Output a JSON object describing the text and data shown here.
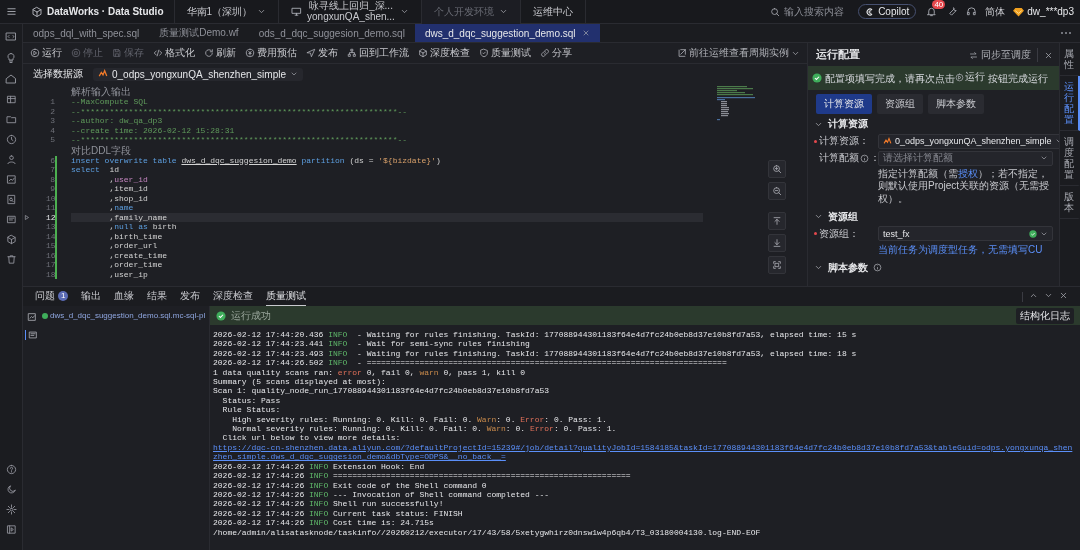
{
  "topbar": {
    "logo": "DataWorks · Data Studio",
    "region": "华南1（深圳）",
    "workspace": {
      "name": "咏寻线上回归_深...",
      "id": "yongxunQA_shen..."
    },
    "env": {
      "label": "个人开发环境",
      "disabled": true
    },
    "ops": "运维中心",
    "search": {
      "placeholder": "输入搜索内容"
    },
    "copilot": "Copilot",
    "notifications": "40",
    "language": "简体",
    "user": "dw_***dp3"
  },
  "tabs": [
    {
      "label": "odps_dql_with_spec.sql",
      "selected": false
    },
    {
      "label": "质量测试Demo.wf",
      "selected": false
    },
    {
      "label": "ods_d_dqc_suggesion_demo.sql",
      "selected": false
    },
    {
      "label": "dws_d_dqc_suggestion_demo.sql",
      "selected": true
    }
  ],
  "toolbar": {
    "actions": [
      {
        "label": "运行",
        "disabled": false
      },
      {
        "label": "停止",
        "disabled": true
      },
      {
        "label": "保存",
        "disabled": true
      },
      {
        "label": "格式化",
        "disabled": false
      },
      {
        "label": "刷新",
        "disabled": false
      },
      {
        "label": "费用预估",
        "disabled": false
      },
      {
        "label": "发布",
        "disabled": false
      },
      {
        "label": "回到工作流",
        "disabled": false
      },
      {
        "label": "深度检查",
        "disabled": false
      },
      {
        "label": "质量测试",
        "disabled": false
      },
      {
        "label": "分享",
        "disabled": false
      }
    ],
    "goto": "前往运维查看周期实例"
  },
  "datasource": {
    "label": "选择数据源",
    "value": "0_odps_yongxunQA_shenzhen_simple"
  },
  "editor": {
    "lines": [
      {
        "kind": "lens",
        "text": "解析输入输出"
      },
      {
        "kind": "code",
        "number": "1",
        "current": false,
        "changed": false,
        "run_button": false,
        "tokens": [
          {
            "kind": "comment",
            "text": "--MaxCompute SQL"
          }
        ]
      },
      {
        "kind": "code",
        "number": "2",
        "current": false,
        "changed": false,
        "run_button": false,
        "tokens": [
          {
            "kind": "comment",
            "text": "--******************************************************************--"
          }
        ]
      },
      {
        "kind": "code",
        "number": "3",
        "current": false,
        "changed": false,
        "run_button": false,
        "tokens": [
          {
            "kind": "comment",
            "text": "--author: dw_qa_dp3"
          }
        ]
      },
      {
        "kind": "code",
        "number": "4",
        "current": false,
        "changed": false,
        "run_button": false,
        "tokens": [
          {
            "kind": "comment",
            "text": "--create time: 2026-02-12 15:28:31"
          }
        ]
      },
      {
        "kind": "code",
        "number": "5",
        "current": false,
        "changed": false,
        "run_button": false,
        "tokens": [
          {
            "kind": "comment",
            "text": "--******************************************************************--"
          }
        ]
      },
      {
        "kind": "lens",
        "text": "对比DDL字段"
      },
      {
        "kind": "code",
        "number": "6",
        "current": false,
        "changed": true,
        "run_button": false,
        "tokens": [
          {
            "kind": "keyword",
            "text": "insert overwrite table "
          },
          {
            "kind": "table",
            "text": "dws_d_dqc_suggesion_demo"
          },
          {
            "kind": "keyword",
            "text": " partition"
          },
          {
            "kind": "plain",
            "text": " (ds = "
          },
          {
            "kind": "string",
            "text": "'${bizdate}'"
          },
          {
            "kind": "plain",
            "text": ")"
          }
        ]
      },
      {
        "kind": "code",
        "number": "7",
        "current": false,
        "changed": true,
        "run_button": false,
        "tokens": [
          {
            "kind": "keyword",
            "text": "select"
          },
          {
            "kind": "plain",
            "text": "  id"
          }
        ]
      },
      {
        "kind": "code",
        "number": "8",
        "current": false,
        "changed": true,
        "run_button": false,
        "tokens": [
          {
            "kind": "plain",
            "text": "        ,"
          },
          {
            "kind": "field",
            "text": "user_id"
          }
        ]
      },
      {
        "kind": "code",
        "number": "9",
        "current": false,
        "changed": true,
        "run_button": false,
        "tokens": [
          {
            "kind": "plain",
            "text": "        ,item_id"
          }
        ]
      },
      {
        "kind": "code",
        "number": "10",
        "current": false,
        "changed": true,
        "run_button": false,
        "tokens": [
          {
            "kind": "plain",
            "text": "        ,shop_id"
          }
        ]
      },
      {
        "kind": "code",
        "number": "11",
        "current": false,
        "changed": true,
        "run_button": false,
        "tokens": [
          {
            "kind": "plain",
            "text": "        ,"
          },
          {
            "kind": "keyword",
            "text": "name"
          }
        ]
      },
      {
        "kind": "code",
        "number": "12",
        "current": true,
        "changed": true,
        "run_button": true,
        "tokens": [
          {
            "kind": "plain",
            "text": "        ,family_name"
          }
        ]
      },
      {
        "kind": "code",
        "number": "13",
        "current": false,
        "changed": true,
        "run_button": false,
        "tokens": [
          {
            "kind": "plain",
            "text": "        ,"
          },
          {
            "kind": "keyword",
            "text": "null as"
          },
          {
            "kind": "plain",
            "text": " birth"
          }
        ]
      },
      {
        "kind": "code",
        "number": "14",
        "current": false,
        "changed": true,
        "run_button": false,
        "tokens": [
          {
            "kind": "plain",
            "text": "        ,birth_time"
          }
        ]
      },
      {
        "kind": "code",
        "number": "15",
        "current": false,
        "changed": true,
        "run_button": false,
        "tokens": [
          {
            "kind": "plain",
            "text": "        ,order_url"
          }
        ]
      },
      {
        "kind": "code",
        "number": "16",
        "current": false,
        "changed": true,
        "run_button": false,
        "tokens": [
          {
            "kind": "plain",
            "text": "        ,create_time"
          }
        ]
      },
      {
        "kind": "code",
        "number": "17",
        "current": false,
        "changed": true,
        "run_button": false,
        "tokens": [
          {
            "kind": "plain",
            "text": "        ,order_time"
          }
        ]
      },
      {
        "kind": "code",
        "number": "18",
        "current": false,
        "changed": true,
        "run_button": false,
        "tokens": [
          {
            "kind": "plain",
            "text": "        ,user_ip"
          }
        ]
      }
    ]
  },
  "config": {
    "title": "运行配置",
    "sync": "同步至调度",
    "banner": {
      "before": "配置项填写完成，请再次点击",
      "button": "运行",
      "after": "按钮完成运行"
    },
    "tabs": [
      {
        "label": "计算资源",
        "selected": true
      },
      {
        "label": "资源组",
        "selected": false
      },
      {
        "label": "脚本参数",
        "selected": false
      }
    ],
    "sections": [
      {
        "title": "计算资源",
        "info": false,
        "expanded": true,
        "items": [
          {
            "kind": "source_select",
            "label": "计算资源",
            "colon": "：",
            "required": true,
            "info": false,
            "valid": false,
            "value": "0_odps_yongxunQA_shenzhen_simple"
          },
          {
            "kind": "select",
            "label": "计算配额",
            "colon": "：",
            "required": false,
            "info": true,
            "valid": false,
            "placeholder": "请选择计算配额"
          },
          {
            "kind": "help",
            "before": "指定计算配额（需",
            "link": "授权",
            "after": "）；若不指定，则默认使用Project关联的资源（无需授权）。"
          }
        ]
      },
      {
        "title": "资源组",
        "info": false,
        "expanded": true,
        "items": [
          {
            "kind": "select",
            "label": "资源组",
            "colon": "：",
            "required": true,
            "info": false,
            "valid": true,
            "value": "test_fx"
          },
          {
            "kind": "note",
            "text": "当前任务为调度型任务，无需填写CU"
          }
        ]
      },
      {
        "title": "脚本参数",
        "info": true,
        "expanded": true
      }
    ]
  },
  "side_tabs": [
    {
      "label": "属性",
      "selected": false
    },
    {
      "label": "运行配置",
      "selected": true
    },
    {
      "label": "调度配置",
      "selected": false
    },
    {
      "label": "版本",
      "selected": false
    }
  ],
  "bottom": {
    "tabs": [
      {
        "label": "问题",
        "badge": "1",
        "selected": false
      },
      {
        "label": "输出",
        "selected": false
      },
      {
        "label": "血缘",
        "selected": false
      },
      {
        "label": "结果",
        "selected": false
      },
      {
        "label": "发布",
        "selected": false
      },
      {
        "label": "深度检查",
        "selected": false
      },
      {
        "label": "质量测试",
        "selected": true
      }
    ],
    "files": [
      {
        "name": "dws_d_dqc_suggestion_demo.sql.mc-sql-pl",
        "succeeded": true
      }
    ],
    "log": {
      "succeeded": true,
      "status_text": "运行成功",
      "structured_button": "结构化日志",
      "lines": [
        [
          {
            "kind": "plain",
            "text": "2026-02-12 17:44:20.436 "
          },
          {
            "kind": "info",
            "text": "INFO"
          },
          {
            "kind": "plain",
            "text": "  - Waiting for rules finishing. TaskId: 177088944301183f64e4d7fc24b0eb8d37e10b8fd7a53, elapsed time: 15 s"
          }
        ],
        [
          {
            "kind": "plain",
            "text": "2026-02-12 17:44:23.441 "
          },
          {
            "kind": "info",
            "text": "INFO"
          },
          {
            "kind": "plain",
            "text": "  - Wait for semi-sync rules finishing"
          }
        ],
        [
          {
            "kind": "plain",
            "text": "2026-02-12 17:44:23.493 "
          },
          {
            "kind": "info",
            "text": "INFO"
          },
          {
            "kind": "plain",
            "text": "  - Waiting for rules finishing. TaskId: 177088944301183f64e4d7fc24b0eb8d37e10b8fd7a53, elapsed time: 18 s"
          }
        ],
        [
          {
            "kind": "plain",
            "text": "2026-02-12 17:44:26.502 "
          },
          {
            "kind": "info",
            "text": "INFO"
          },
          {
            "kind": "plain",
            "text": "  - ==========================================================================="
          }
        ],
        [
          {
            "kind": "plain",
            "text": "1 data quality scans ran: "
          },
          {
            "kind": "error",
            "text": "error"
          },
          {
            "kind": "plain",
            "text": " 0, fail 0, "
          },
          {
            "kind": "warn",
            "text": "warn"
          },
          {
            "kind": "plain",
            "text": " 0, pass 1, kill 0"
          }
        ],
        [
          {
            "kind": "plain",
            "text": "Summary (5 scans displayed at most):"
          }
        ],
        [
          {
            "kind": "plain",
            "text": "Scan 1: quality_node_run_177088944301183f64e4d7fc24b0eb8d37e10b8fd7a53"
          }
        ],
        [
          {
            "kind": "plain",
            "text": "  Status: Pass"
          }
        ],
        [
          {
            "kind": "plain",
            "text": "  Rule Status:"
          }
        ],
        [
          {
            "kind": "plain",
            "text": "    High severity rules: Running: 0. Kill: 0. Fail: 0. "
          },
          {
            "kind": "warn",
            "text": "Warn"
          },
          {
            "kind": "plain",
            "text": ": 0. "
          },
          {
            "kind": "error",
            "text": "Error"
          },
          {
            "kind": "plain",
            "text": ": 0. Pass: 1."
          }
        ],
        [
          {
            "kind": "plain",
            "text": "    Normal severity rules: Running: 0. Kill: 0. Fail: 0. "
          },
          {
            "kind": "warn",
            "text": "Warn"
          },
          {
            "kind": "plain",
            "text": ": 0. "
          },
          {
            "kind": "error",
            "text": "Error"
          },
          {
            "kind": "plain",
            "text": ": 0. Pass: 1."
          }
        ],
        [
          {
            "kind": "plain",
            "text": "  Click url below to view more details: "
          },
          {
            "kind": "link",
            "text": "https://dqc-cn-shenzhen.data.aliyun.com/?defaultProjectId=15239#/job/detail?qualityJobId=1584185&taskId=177088944301183f64e4d7fc24b0eb8d37e10b8fd7a53&tableGuid=odps.yongxunqa_shen"
          }
        ],
        [
          {
            "kind": "link",
            "text": "zhen_simple.dws_d_dqc_suggesion_demo&dbType=ODPS&__no_back__="
          }
        ],
        [
          {
            "kind": "plain",
            "text": "2026-02-12 17:44:26 "
          },
          {
            "kind": "info",
            "text": "INFO"
          },
          {
            "kind": "plain",
            "text": " Extension Hook: End"
          }
        ],
        [
          {
            "kind": "plain",
            "text": "2026-02-12 17:44:26 "
          },
          {
            "kind": "info",
            "text": "INFO"
          },
          {
            "kind": "plain",
            "text": " =============================================================="
          }
        ],
        [
          {
            "kind": "plain",
            "text": "2026-02-12 17:44:26 "
          },
          {
            "kind": "info",
            "text": "INFO"
          },
          {
            "kind": "plain",
            "text": " Exit code of the Shell command 0"
          }
        ],
        [
          {
            "kind": "plain",
            "text": "2026-02-12 17:44:26 "
          },
          {
            "kind": "info",
            "text": "INFO"
          },
          {
            "kind": "plain",
            "text": " --- Invocation of Shell command completed ---"
          }
        ],
        [
          {
            "kind": "plain",
            "text": "2026-02-12 17:44:26 "
          },
          {
            "kind": "info",
            "text": "INFO"
          },
          {
            "kind": "plain",
            "text": " Shell run successfully!"
          }
        ],
        [
          {
            "kind": "plain",
            "text": "2026-02-12 17:44:26 "
          },
          {
            "kind": "info",
            "text": "INFO"
          },
          {
            "kind": "plain",
            "text": " Current task status: FINISH"
          }
        ],
        [
          {
            "kind": "plain",
            "text": "2026-02-12 17:44:26 "
          },
          {
            "kind": "info",
            "text": "INFO"
          },
          {
            "kind": "plain",
            "text": " Cost time is: 24.715s"
          }
        ],
        [
          {
            "kind": "plain",
            "text": "/home/admin/alisatasknode/taskinfo//20260212/executor/17/43/58/5xetygwhirz0dnsw1w4p6qb4/T3_03180004130.log-END-EOF"
          }
        ]
      ]
    }
  }
}
